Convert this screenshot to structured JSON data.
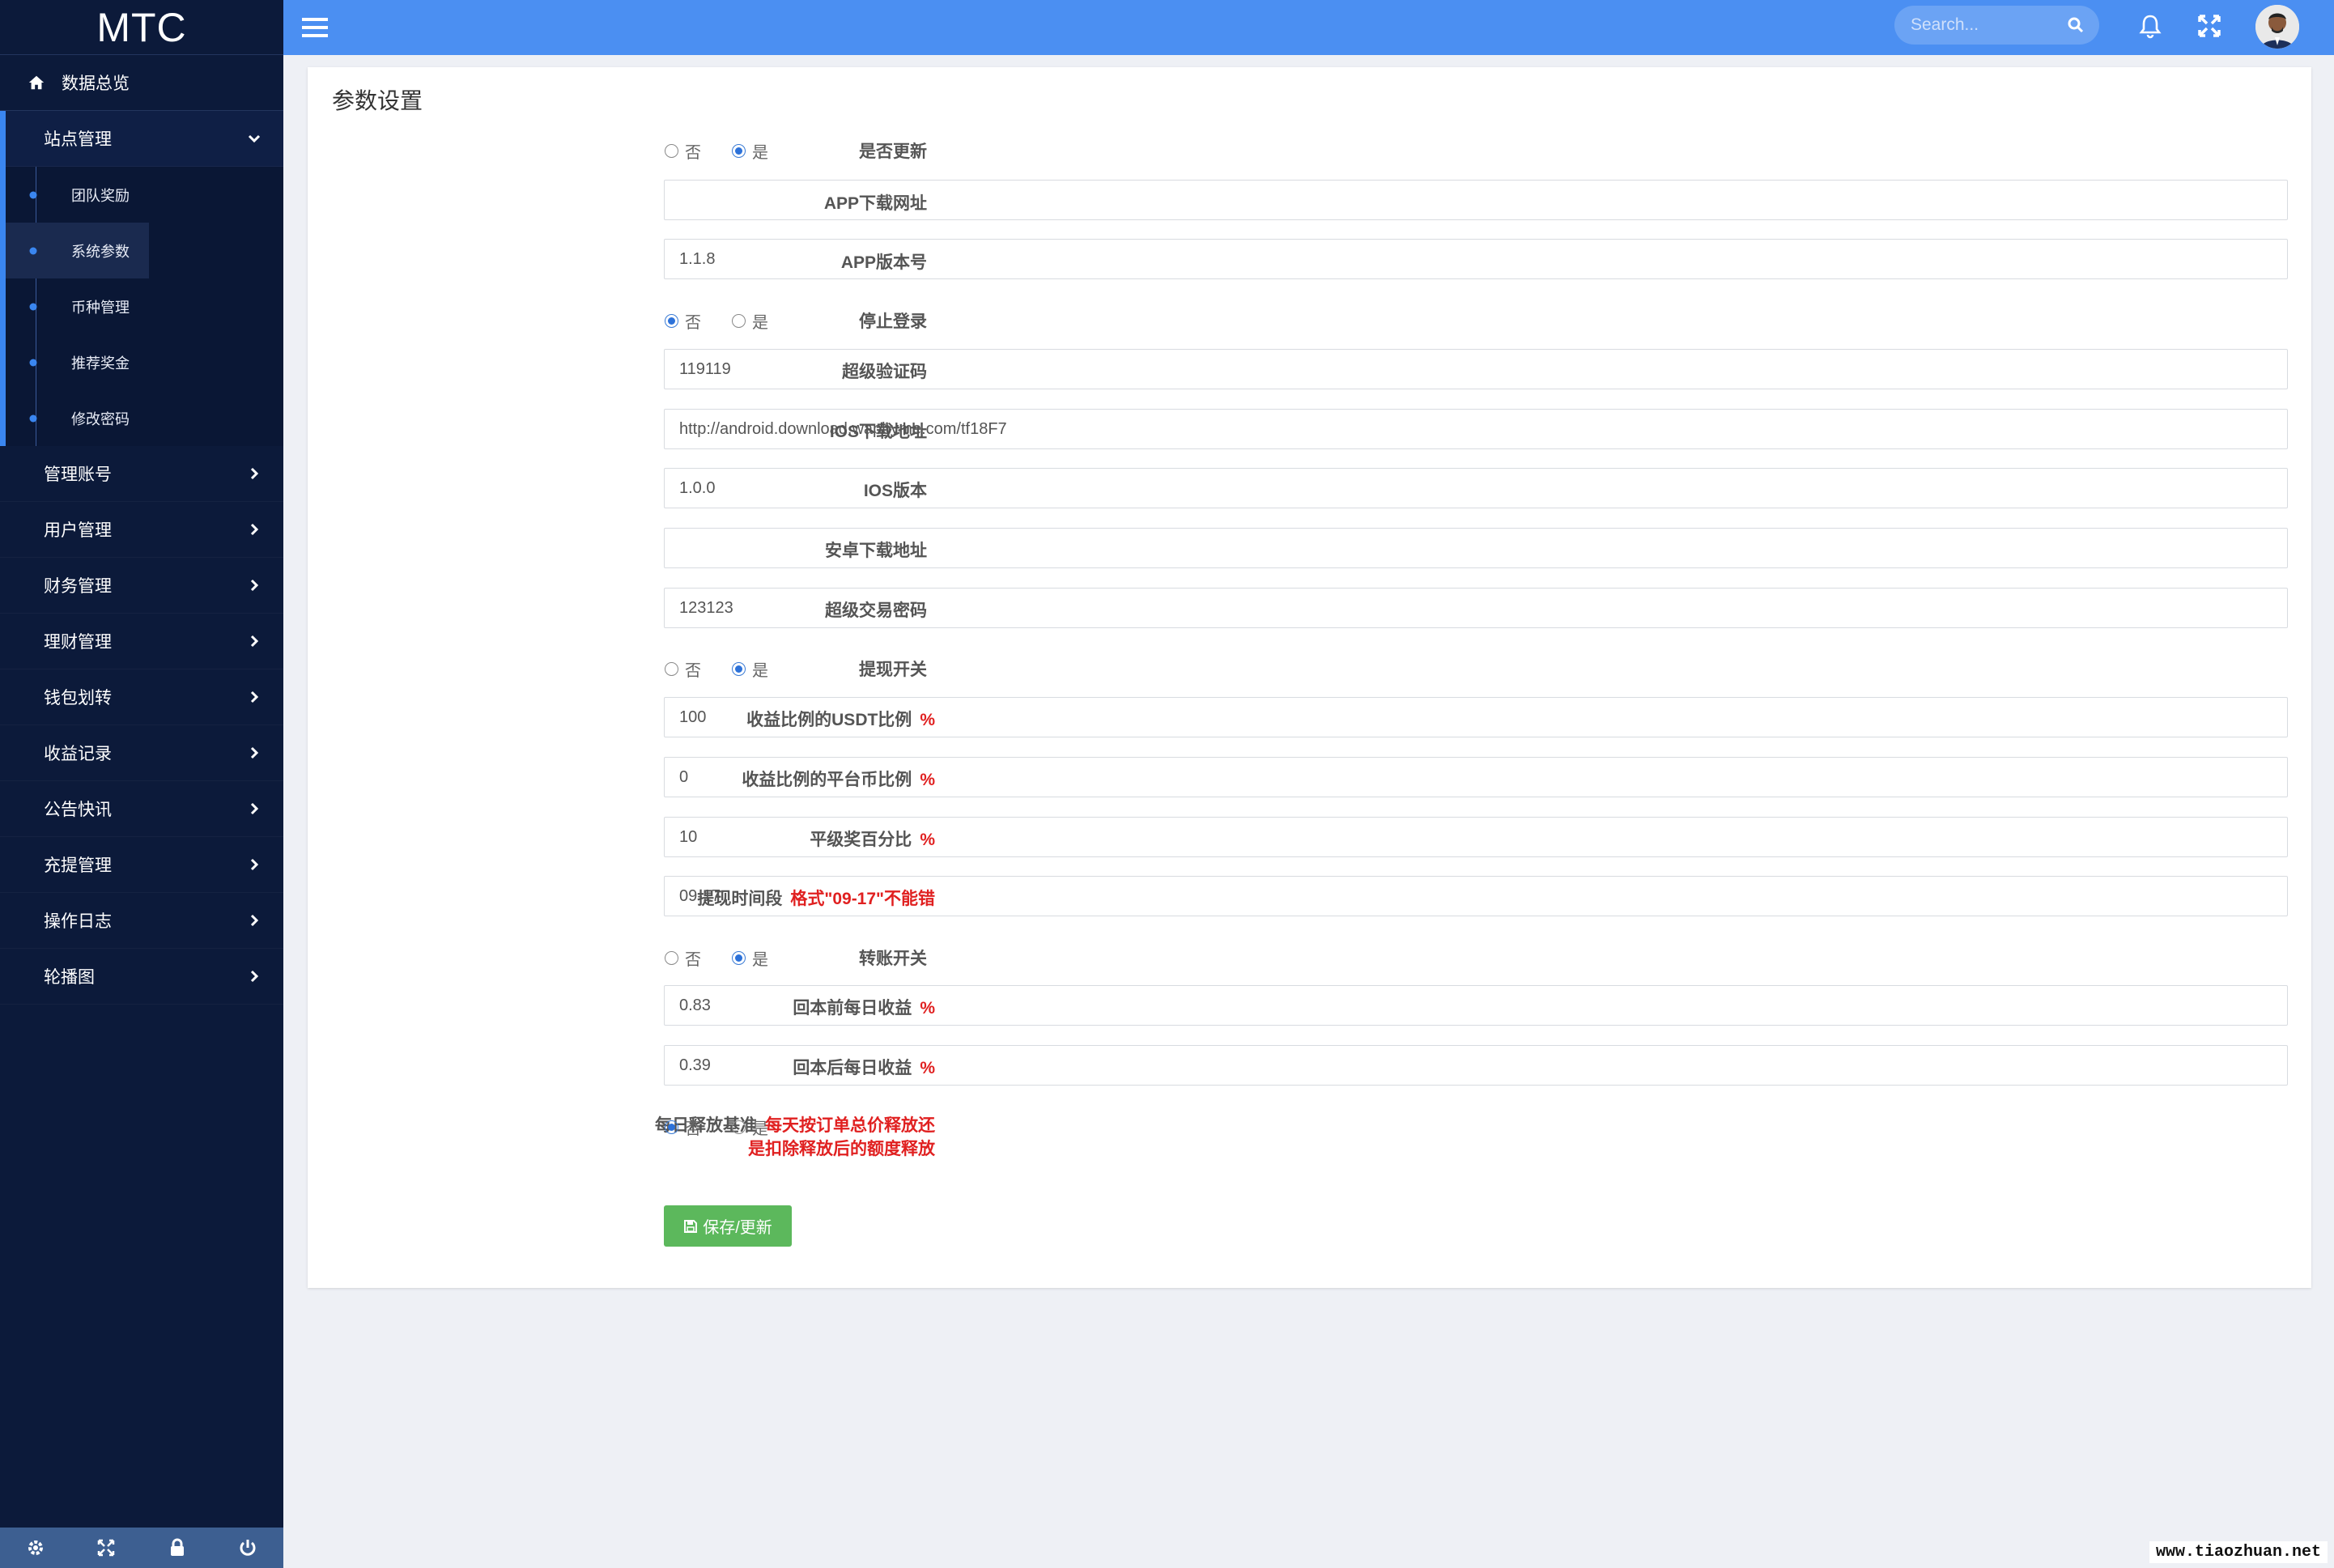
{
  "brand": "MTC",
  "sidebar": {
    "dashboard": "数据总览",
    "site_management": "站点管理",
    "submenu": [
      "团队奖励",
      "系统参数",
      "币种管理",
      "推荐奖金",
      "修改密码"
    ],
    "items": [
      "管理账号",
      "用户管理",
      "财务管理",
      "理财管理",
      "钱包划转",
      "收益记录",
      "公告快讯",
      "充提管理",
      "操作日志",
      "轮播图"
    ]
  },
  "topbar": {
    "search_placeholder": "Search..."
  },
  "page": {
    "title": "参数设置",
    "radio_no": "否",
    "radio_yes": "是",
    "save_label": "保存/更新"
  },
  "fields": {
    "is_update": {
      "label": "是否更新",
      "value": "是"
    },
    "app_download_url": {
      "label": "APP下载网址",
      "value": ""
    },
    "app_version": {
      "label": "APP版本号",
      "value": "1.1.8"
    },
    "stop_login": {
      "label": "停止登录",
      "value": "否"
    },
    "super_code": {
      "label": "超级验证码",
      "value": "119119"
    },
    "ios_download_url": {
      "label": "IOS下载地址",
      "value": "http://android.download.wapbyme.com/tf18F7"
    },
    "ios_version": {
      "label": "IOS版本",
      "value": "1.0.0"
    },
    "android_download_url": {
      "label": "安卓下载地址",
      "value": ""
    },
    "super_trade_password": {
      "label": "超级交易密码",
      "value": "123123"
    },
    "withdraw_switch": {
      "label": "提现开关",
      "value": "是"
    },
    "usdt_ratio": {
      "label": "收益比例的USDT比例",
      "note": "%",
      "value": "100"
    },
    "platform_coin_ratio": {
      "label": "收益比例的平台币比例",
      "note": "%",
      "value": "0"
    },
    "peer_bonus": {
      "label": "平级奖百分比",
      "note": "%",
      "value": "10"
    },
    "withdraw_time": {
      "label": "提现时间段",
      "note": "格式\"09-17\"不能错",
      "value": "09-17"
    },
    "transfer_switch": {
      "label": "转账开关",
      "value": "是"
    },
    "daily_before": {
      "label": "回本前每日收益",
      "note": "%",
      "value": "0.83"
    },
    "daily_after": {
      "label": "回本后每日收益",
      "note": "%",
      "value": "0.39"
    },
    "daily_release": {
      "label": "每日释放基准",
      "note_line1": "每天按订单总价释放还",
      "note_line2": "是扣除释放后的额度释放",
      "value": "否"
    }
  },
  "colors": {
    "sidebar_bg": "#0c1a3a",
    "topbar_bg": "#4b8ff2",
    "accent": "#3a86f0",
    "save_button": "#5cb85c",
    "note_red": "#e02020"
  },
  "watermark": "www.tiaozhuan.net"
}
